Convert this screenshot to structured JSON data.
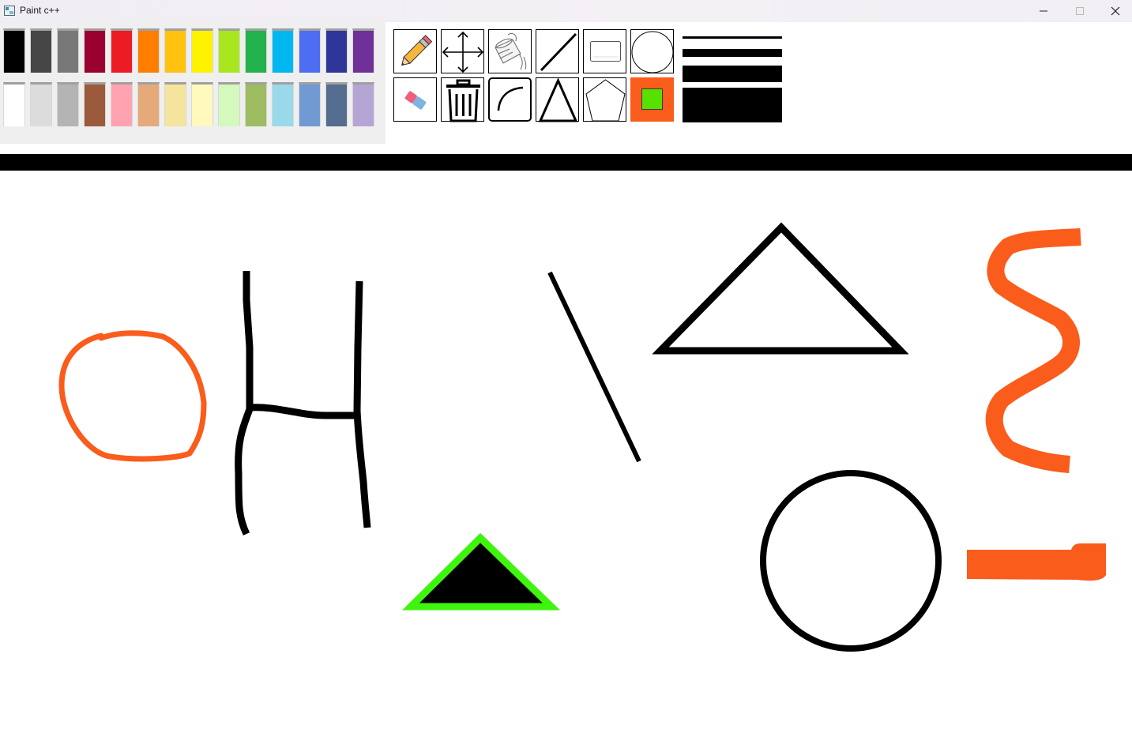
{
  "window": {
    "title": "Paint c++",
    "controls": [
      "minimize",
      "maximize",
      "close"
    ]
  },
  "palette": {
    "row1": [
      "#000000",
      "#464646",
      "#787878",
      "#990030",
      "#ed1c24",
      "#ff7e00",
      "#ffc20e",
      "#fff200",
      "#a8e61d",
      "#22b14c",
      "#00b7ef",
      "#4d6df3",
      "#2f3699",
      "#6f3198"
    ],
    "row2": [
      "#ffffff",
      "#dcdcdc",
      "#b4b4b4",
      "#9c5a3c",
      "#ffa3b1",
      "#e5aa7a",
      "#f5e49c",
      "#fff9bd",
      "#d3f9bc",
      "#9dbb61",
      "#99d9ea",
      "#709ad1",
      "#546d8e",
      "#b5a5d5"
    ]
  },
  "tools": {
    "row1": [
      "pencil",
      "move",
      "fill-bucket",
      "line",
      "rectangle",
      "ellipse"
    ],
    "row2": [
      "eraser",
      "trash",
      "curve",
      "triangle",
      "pentagon",
      "current-color"
    ]
  },
  "colors": {
    "current_fill": "#56e100",
    "current_border": "#fa5c1c",
    "stroke_orange": "#fa5c1c",
    "stroke_black": "#000000",
    "stroke_green": "#3ff40f"
  },
  "line_widths": [
    "thin",
    "medium",
    "thick",
    "extra-thick"
  ]
}
